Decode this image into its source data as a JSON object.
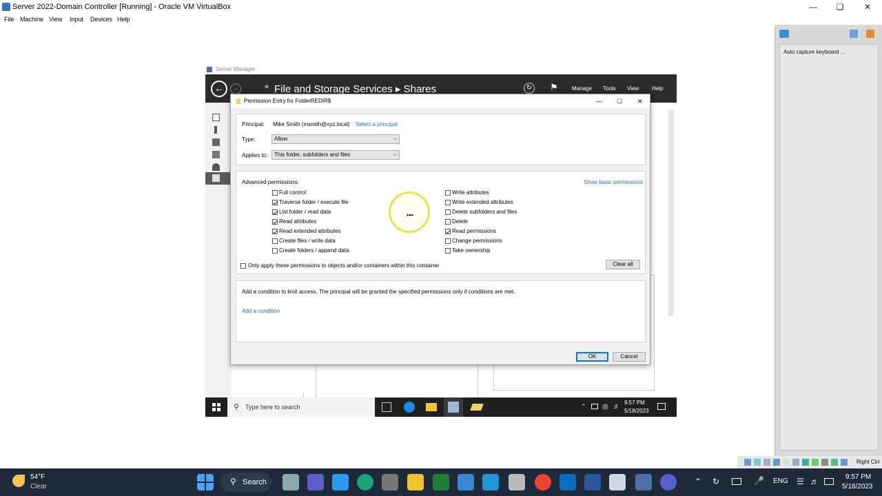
{
  "host_window": {
    "title": "Server 2022-Domain Controller [Running] - Oracle VM VirtualBox",
    "menu": [
      "File",
      "Machine",
      "View",
      "Input",
      "Devices",
      "Help"
    ],
    "side_panel_label": "Auto capture keyboard ...",
    "status_text": "Right Ctrl"
  },
  "server_manager": {
    "title": "Server Manager",
    "breadcrumb": "File and Storage Services  ▸  Shares",
    "menu": [
      "Manage",
      "Tools",
      "View",
      "Help"
    ]
  },
  "vm_taskbar": {
    "search_placeholder": "Type here to search",
    "time": "9:57 PM",
    "date": "5/18/2023"
  },
  "dialog": {
    "title": "Permission Entry for FolderREDIR$",
    "principal_label": "Principal:",
    "principal_value": "Mike Smith (msmith@xyz.local)",
    "select_principal_link": "Select a principal",
    "type_label": "Type:",
    "type_value": "Allow",
    "applies_label": "Applies to:",
    "applies_value": "This folder, subfolders and files",
    "advanced_label": "Advanced permissions:",
    "show_basic_link": "Show basic permissions",
    "permissions_left": [
      {
        "label": "Full control",
        "checked": false
      },
      {
        "label": "Traverse folder / execute file",
        "checked": true
      },
      {
        "label": "List folder / read data",
        "checked": true
      },
      {
        "label": "Read attributes",
        "checked": true
      },
      {
        "label": "Read extended attributes",
        "checked": true
      },
      {
        "label": "Create files / write data",
        "checked": false
      },
      {
        "label": "Create folders / append data",
        "checked": false
      }
    ],
    "permissions_right": [
      {
        "label": "Write attributes",
        "checked": false
      },
      {
        "label": "Write extended attributes",
        "checked": false
      },
      {
        "label": "Delete subfolders and files",
        "checked": false
      },
      {
        "label": "Delete",
        "checked": false
      },
      {
        "label": "Read permissions",
        "checked": true
      },
      {
        "label": "Change permissions",
        "checked": false
      },
      {
        "label": "Take ownership",
        "checked": false
      }
    ],
    "only_apply_label": "Only apply these permissions to objects and/or containers within this container",
    "clear_all": "Clear all",
    "condition_text": "Add a condition to limit access. The principal will be granted the specified permissions only if conditions are met.",
    "add_condition_link": "Add a condition",
    "ok": "OK",
    "cancel": "Cancel"
  },
  "host_taskbar": {
    "weather_temp": "54°F",
    "weather_desc": "Clear",
    "search_label": "Search",
    "lang": "ENG",
    "time": "9:57 PM",
    "date": "5/18/2023"
  }
}
